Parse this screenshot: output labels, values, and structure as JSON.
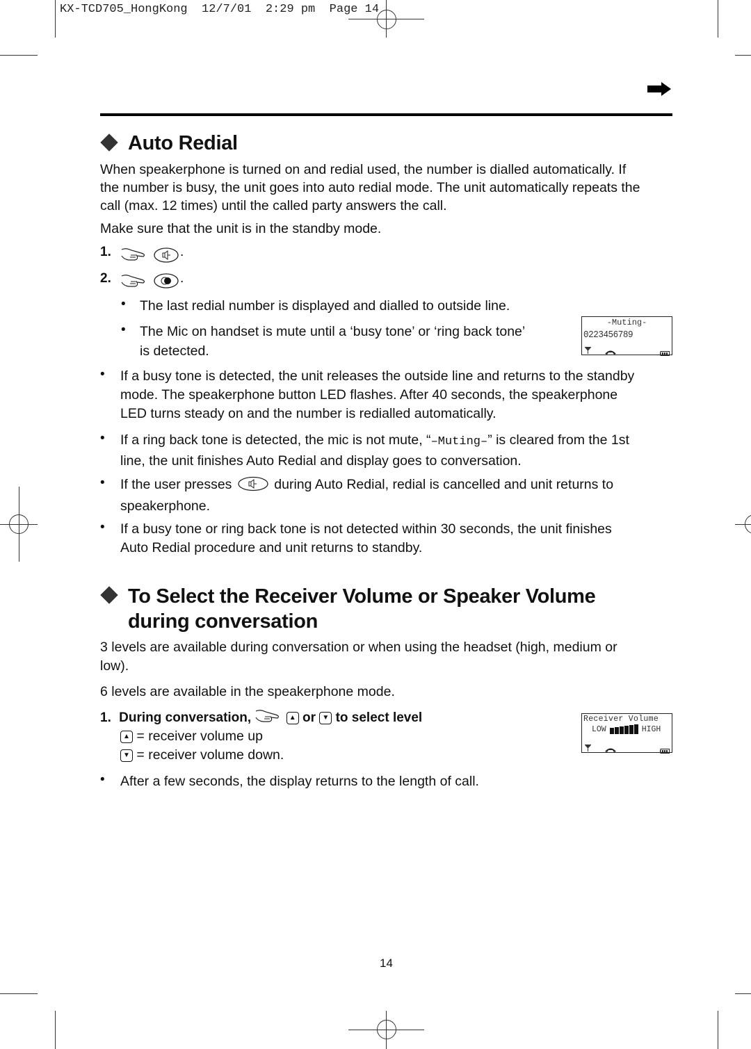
{
  "print_header": {
    "text": "KX-TCD705_HongKong  12/7/01  2:29 pm  Page 14"
  },
  "section1": {
    "title": "Auto Redial",
    "intro": [
      "When speakerphone is turned on and redial used, the number is dialled automatically. If",
      "the number is busy, the unit goes into auto redial mode. The unit automatically repeats the",
      "call (max. 12 times) until the called party answers the call."
    ],
    "precondition": "Make sure that the unit is in the standby mode.",
    "steps": [
      {
        "num": "1.",
        "button_icon": "speakerphone-button-icon"
      },
      {
        "num": "2.",
        "button_icon": "redial-button-icon"
      }
    ],
    "sub_bullets": [
      "The last redial number is displayed and dialled to outside line.",
      "The Mic on handset is mute until a ‘busy tone’ or ‘ring back tone’",
      "is detected."
    ],
    "bullets": {
      "busy": [
        "If a busy tone is detected, the unit releases the outside line and returns to the standby",
        "mode. The speakerphone button LED flashes. After 40 seconds, the speakerphone",
        "LED turns steady on and the number is redialled automatically."
      ],
      "ringback_pre": "If a ring back tone is detected, the mic is not mute, “",
      "ringback_code": "–Muting–",
      "ringback_post": "” is cleared from the 1st",
      "ringback_line2": "line, the unit finishes Auto Redial and display goes to conversation.",
      "presses_pre": "If the user presses",
      "presses_post": "during Auto Redial, redial is cancelled and unit returns to",
      "presses_line2": "speakerphone.",
      "timeout": [
        "If a busy tone or ring back tone is not detected within 30 seconds, the unit finishes",
        "Auto Redial procedure and unit returns to standby."
      ]
    },
    "lcd": {
      "line1": "-Muting-",
      "line2": "0223456789"
    }
  },
  "section2": {
    "title_line1": "To Select the Receiver Volume or Speaker Volume",
    "title_line2": "during conversation",
    "para1": [
      "3 levels are available during conversation or when using the headset (high, medium or",
      "low)."
    ],
    "para2": "6 levels are available in the speakerphone mode.",
    "step": {
      "num": "1.",
      "pre": "During conversation,",
      "or": "or",
      "post": "to select level",
      "up_desc": "= receiver volume up",
      "down_desc": "= receiver volume down."
    },
    "after": "After a few seconds, the display returns to the length of call.",
    "lcd": {
      "line1": "Receiver Volume",
      "low": "LOW",
      "high": "HIGH",
      "volume_level": 6,
      "volume_max": 6
    }
  },
  "page_number": "14"
}
